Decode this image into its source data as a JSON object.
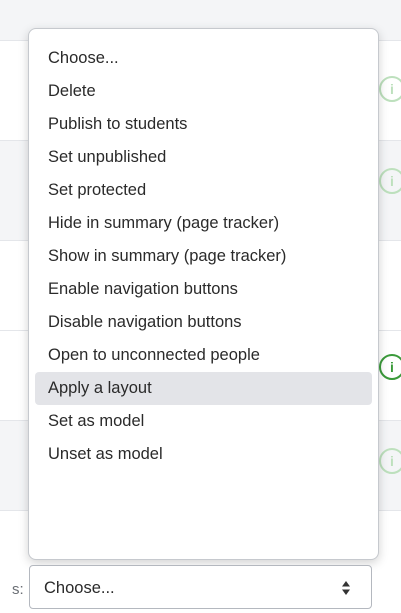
{
  "dropdown": {
    "items": [
      {
        "label": "Choose..."
      },
      {
        "label": "Delete"
      },
      {
        "label": "Publish to students"
      },
      {
        "label": "Set unpublished"
      },
      {
        "label": "Set protected"
      },
      {
        "label": "Hide in summary (page tracker)"
      },
      {
        "label": "Show in summary (page tracker)"
      },
      {
        "label": "Enable navigation buttons"
      },
      {
        "label": "Disable navigation buttons"
      },
      {
        "label": "Open to unconnected people"
      },
      {
        "label": "Apply a layout"
      },
      {
        "label": "Set as model"
      },
      {
        "label": "Unset as model"
      }
    ],
    "highlighted_label": "Apply a layout"
  },
  "select": {
    "label_tail": "s:",
    "value": "Choose..."
  },
  "colors": {
    "highlight": "#e3e4e8",
    "indicator_strong": "#3a9a3a",
    "indicator_faded": "#bde0bd"
  }
}
